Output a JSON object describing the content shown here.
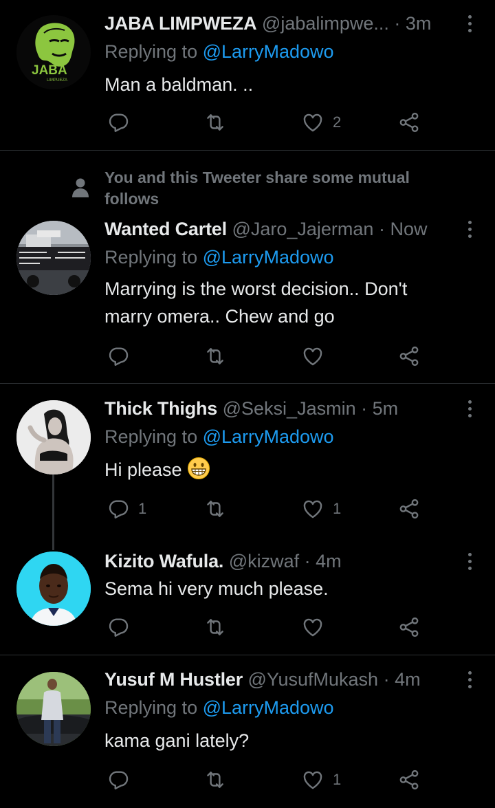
{
  "tweets": [
    {
      "name": "JABA LIMPWEZA",
      "handle": "@jabalimpwe...",
      "time": "3m",
      "replying_prefix": "Replying to ",
      "mention": "@LarryMadowo",
      "text": "Man a baldman. ..",
      "avatar_text": "JABA",
      "avatar_subtext": "LIMPUEZA",
      "reply_count": "",
      "retweet_count": "",
      "like_count": "2"
    },
    {
      "mutual_note": "You and this Tweeter share some mutual follows",
      "name": "Wanted Cartel",
      "handle": "@Jaro_Jajerman",
      "time": "Now",
      "replying_prefix": "Replying to ",
      "mention": "@LarryMadowo",
      "text": "Marrying is the worst decision.. Don't marry omera.. Chew and go",
      "reply_count": "",
      "retweet_count": "",
      "like_count": ""
    },
    {
      "name": "Thick Thighs",
      "handle": "@Seksi_Jasmin",
      "time": "5m",
      "replying_prefix": "Replying to ",
      "mention": "@LarryMadowo",
      "text": "Hi please",
      "emoji": "grinning-face-emoji",
      "reply_count": "1",
      "retweet_count": "",
      "like_count": "1"
    },
    {
      "name": "Kizito Wafula.",
      "handle": "@kizwaf",
      "time": "4m",
      "text": "Sema hi very much please.",
      "reply_count": "",
      "retweet_count": "",
      "like_count": ""
    },
    {
      "name": "Yusuf M Hustler",
      "handle": "@YusufMukash",
      "time": "4m",
      "replying_prefix": "Replying to ",
      "mention": "@LarryMadowo",
      "text": "kama gani lately?",
      "reply_count": "",
      "retweet_count": "",
      "like_count": "1"
    }
  ],
  "separator": " · ",
  "icons": {
    "reply": "reply-icon",
    "retweet": "retweet-icon",
    "like": "heart-icon",
    "share": "share-icon",
    "more": "more-icon",
    "mutual": "person-icon"
  },
  "colors": {
    "background": "#000000",
    "text": "#e7e9ea",
    "muted": "#71767b",
    "link": "#1d9bf0",
    "divider": "#2f3336",
    "jaba_green": "#8cc63f"
  }
}
